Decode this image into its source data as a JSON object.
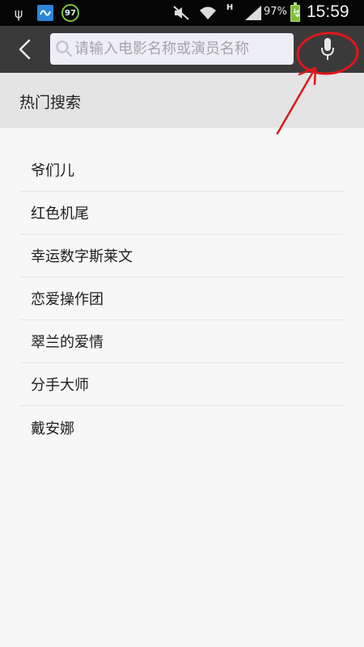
{
  "status_bar": {
    "notification_badge": "97",
    "network_type": "H",
    "battery_percent": "97%",
    "time": "15:59"
  },
  "search": {
    "placeholder": "请输入电影名称或演员名称",
    "value": ""
  },
  "hot_search": {
    "title": "热门搜索",
    "items": [
      {
        "label": "爷们儿"
      },
      {
        "label": "红色机尾"
      },
      {
        "label": "幸运数字斯莱文"
      },
      {
        "label": "恋爱操作团"
      },
      {
        "label": "翠兰的爱情"
      },
      {
        "label": "分手大师"
      },
      {
        "label": "戴安娜"
      }
    ]
  },
  "icons": {
    "back": "chevron-left-icon",
    "search": "search-icon",
    "voice": "microphone-icon"
  },
  "colors": {
    "header_bg": "#3a3a3a",
    "section_bg": "#e4e4e4",
    "annotation_red": "#e0161c"
  }
}
